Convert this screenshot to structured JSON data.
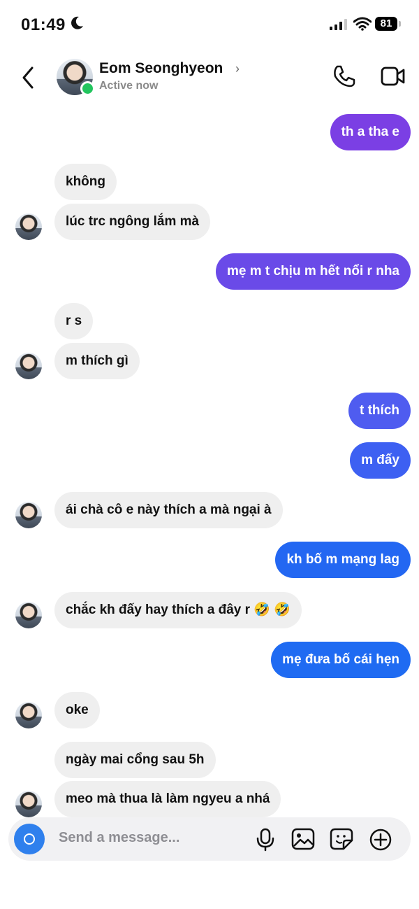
{
  "status": {
    "time": "01:49",
    "battery": "81"
  },
  "header": {
    "name": "Eom Seonghyeon",
    "status": "Active now"
  },
  "messages": [
    {
      "dir": "out",
      "text": "th a tha e"
    },
    {
      "dir": "in",
      "text": "không"
    },
    {
      "dir": "in",
      "text": "lúc trc ngông lắm mà"
    },
    {
      "dir": "out",
      "text": "mẹ m t chịu m hết nổi r nha"
    },
    {
      "dir": "in",
      "text": "r s"
    },
    {
      "dir": "in",
      "text": "m thích gì"
    },
    {
      "dir": "out",
      "text": "t thích"
    },
    {
      "dir": "out",
      "text": "m đấy"
    },
    {
      "dir": "in",
      "text": "ái chà cô e này thích a mà ngại à"
    },
    {
      "dir": "out",
      "text": "kh bố m mạng lag"
    },
    {
      "dir": "in",
      "text": "chắc kh đấy hay thích a đây r 🤣 🤣"
    },
    {
      "dir": "out",
      "text": "mẹ đưa bố cái hẹn"
    },
    {
      "dir": "in",
      "text": "oke"
    },
    {
      "dir": "in",
      "text": "ngày mai cổng sau 5h"
    },
    {
      "dir": "in",
      "text": "meo mà thua là làm ngyeu a nhá"
    }
  ],
  "composer": {
    "placeholder": "Send a message..."
  },
  "colors": {
    "accent_purple": "#7b3fe4",
    "accent_blue": "#1f6bf2",
    "incoming_bg": "#efefef"
  }
}
